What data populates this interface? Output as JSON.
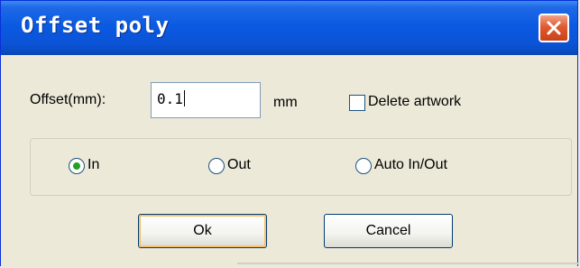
{
  "window": {
    "title": "Offset poly"
  },
  "offset": {
    "label": "Offset(mm):",
    "value": "0.1",
    "unit": "mm"
  },
  "delete_artwork": {
    "label": "Delete artwork",
    "checked": false
  },
  "direction": {
    "options": [
      {
        "label": "In",
        "selected": true
      },
      {
        "label": "Out",
        "selected": false
      },
      {
        "label": "Auto In/Out",
        "selected": false
      }
    ]
  },
  "buttons": {
    "ok": "Ok",
    "cancel": "Cancel"
  }
}
